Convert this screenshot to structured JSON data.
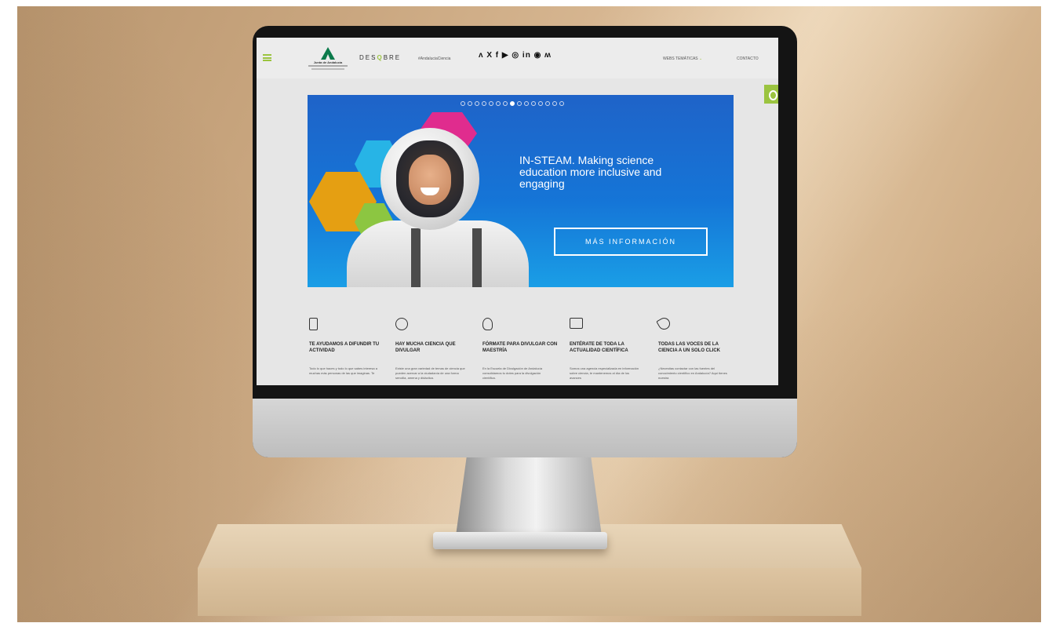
{
  "nav": {
    "brand": {
      "pre": "DES",
      "highlight": "Q",
      "post": "BRE"
    },
    "logo_text": "Junta de Andalucía",
    "hashtag": "#AndaluciaCiencia",
    "social": [
      {
        "icon": "rss-icon",
        "glyph": "ᴧ"
      },
      {
        "icon": "x-icon",
        "glyph": "X"
      },
      {
        "icon": "facebook-icon",
        "glyph": "f"
      },
      {
        "icon": "youtube-icon",
        "glyph": "▶"
      },
      {
        "icon": "instagram-icon",
        "glyph": "◎"
      },
      {
        "icon": "linkedin-icon",
        "glyph": "in"
      },
      {
        "icon": "spotify-icon",
        "glyph": "◉"
      },
      {
        "icon": "bluesky-icon",
        "glyph": "ʍ"
      }
    ],
    "webs_tematicas": "WEBS TEMÁTICAS",
    "contacto": "CONTACTO"
  },
  "hero": {
    "title": "IN-STEAM. Making science education more inclusive and engaging",
    "button": "MÁS INFORMACIÓN",
    "slides_total": 15,
    "active_slide": 7
  },
  "features": [
    {
      "icon": "phone-icon",
      "title": "TE AYUDAMOS A DIFUNDIR TU ACTIVIDAD",
      "text": "Todo lo que haces y todo lo que sabes interesa a muchas más personas de las que imaginas. Te"
    },
    {
      "icon": "crosshair-icon",
      "title": "HAY MUCHA CIENCIA QUE DIVULGAR",
      "text": "Existe una gran variedad de temas de ciencia que pueden acercar a la ciudadanía de una forma sencilla, amena y didáctica."
    },
    {
      "icon": "head-icon",
      "title": "FÓRMATE PARA DIVULGAR CON MAESTRÍA",
      "text": "En la Escuela de Divulgación de Andalucía consolidamos tu dotes para la divulgación científica."
    },
    {
      "icon": "screen-icon",
      "title": "ENTÉRATE DE TODA LA ACTUALIDAD CIENTÍFICA",
      "text": "Somos una agencia especializada en información sobre ciencia, te mantenemos al día de los avances"
    },
    {
      "icon": "megaphone-icon",
      "title": "TODAS LAS VOCES DE LA CIENCIA A UN SOLO CLICK",
      "text": "¿Necesitas contactar con las fuentes del conocimiento científico en Andalucía? Aquí tienes nuestra"
    }
  ],
  "colors": {
    "accent": "#9bc440",
    "hero_blue": "#1575d7",
    "pink": "#e02c8e",
    "orange": "#e59f12"
  }
}
